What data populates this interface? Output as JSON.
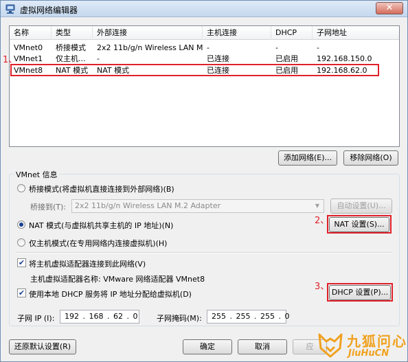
{
  "window": {
    "title": "虚拟网络编辑器",
    "close_label": "✕"
  },
  "table": {
    "columns": [
      "名称",
      "类型",
      "外部连接",
      "主机连接",
      "DHCP",
      "子网地址"
    ],
    "rows": [
      [
        "VMnet0",
        "桥接模式",
        "2x2 11b/g/n Wireless LAN M...",
        "-",
        "-",
        "-"
      ],
      [
        "VMnet1",
        "仅主机...",
        "-",
        "已连接",
        "已启用",
        "192.168.150.0"
      ],
      [
        "VMnet8",
        "NAT 模式",
        "NAT 模式",
        "已连接",
        "已启用",
        "192.168.62.0"
      ]
    ],
    "selected_row": 2
  },
  "list_buttons": {
    "add": "添加网络(E)...",
    "remove": "移除网络(O)"
  },
  "vmnet_info": {
    "group_title": "VMnet 信息",
    "bridged_label": "桥接模式(将虚拟机直接连接到外部网络)(B)",
    "bridged_to_label": "桥接到(T):",
    "bridged_to_value": "2x2 11b/g/n Wireless LAN M.2 Adapter",
    "auto_settings": "自动设置(U)...",
    "nat_label": "NAT 模式(与虚拟机共享主机的 IP 地址)(N)",
    "nat_settings": "NAT 设置(S)...",
    "hostonly_label": "仅主机模式(在专用网络内连接虚拟机)(H)",
    "connect_adapter_label": "将主机虚拟适配器连接到此网络(V)",
    "adapter_name_label": "主机虚拟适配器名称: VMware 网络适配器 VMnet8",
    "dhcp_label": "使用本地 DHCP 服务将 IP 地址分配给虚拟机(D)",
    "dhcp_settings": "DHCP 设置(P)...",
    "subnet_ip_label": "子网 IP (I):",
    "subnet_ip_value": "192 . 168 .  62  .  0",
    "subnet_mask_label": "子网掩码(M):",
    "subnet_mask_value": "255 . 255 . 255 .  0",
    "selected_mode": "nat",
    "connect_adapter_checked": true,
    "dhcp_checked": true
  },
  "footer": {
    "restore": "还原默认设置(R)",
    "ok": "确定",
    "cancel": "取消",
    "apply": "应"
  },
  "annotations": {
    "a1": "1、",
    "a2": "2、",
    "a3": "3、"
  },
  "watermark": {
    "line1": "九狐问心",
    "line2": "JiuHuCN"
  },
  "colors": {
    "highlight_red": "#e0202a",
    "watermark_orange": "#f0a11f"
  }
}
